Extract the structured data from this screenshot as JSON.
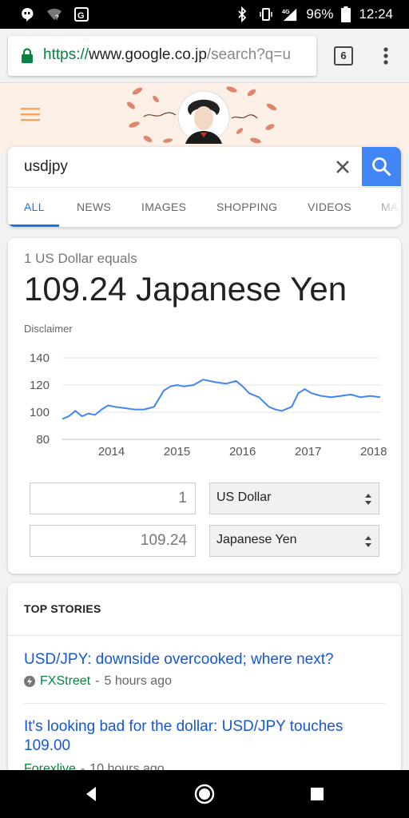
{
  "status_bar": {
    "battery": "96%",
    "time": "12:24",
    "network": "4G"
  },
  "browser": {
    "url_scheme": "https://",
    "url_host": "www.google.co.jp",
    "url_path": "/search?q=u",
    "tab_count": "6"
  },
  "search": {
    "query": "usdjpy",
    "tabs": [
      {
        "label": "ALL"
      },
      {
        "label": "NEWS"
      },
      {
        "label": "IMAGES"
      },
      {
        "label": "SHOPPING"
      },
      {
        "label": "VIDEOS"
      },
      {
        "label": "MA"
      }
    ],
    "active_tab": "ALL"
  },
  "currency": {
    "from_label": "1 US Dollar equals",
    "result": "109.24 Japanese Yen",
    "disclaimer": "Disclaimer",
    "amount_from": "1",
    "currency_from": "US Dollar",
    "amount_to": "109.24",
    "currency_to": "Japanese Yen"
  },
  "chart_data": {
    "type": "line",
    "title": "",
    "xlabel": "",
    "ylabel": "",
    "x_ticks": [
      "2014",
      "2015",
      "2016",
      "2017",
      "2018"
    ],
    "y_ticks": [
      80,
      100,
      120,
      140
    ],
    "ylim": [
      80,
      140
    ],
    "xlim": [
      2013.25,
      2018.1
    ],
    "grid": true,
    "color": "#4285f4",
    "series": [
      {
        "x": [
          2013.25,
          2013.35,
          2013.45,
          2013.55,
          2013.65,
          2013.75,
          2013.85,
          2013.95,
          2014.05,
          2014.2,
          2014.35,
          2014.5,
          2014.65,
          2014.8,
          2014.9,
          2015.0,
          2015.1,
          2015.25,
          2015.4,
          2015.5,
          2015.6,
          2015.75,
          2015.9,
          2016.0,
          2016.1,
          2016.25,
          2016.4,
          2016.5,
          2016.6,
          2016.75,
          2016.85,
          2016.95,
          2017.05,
          2017.2,
          2017.35,
          2017.5,
          2017.65,
          2017.8,
          2017.95,
          2018.1
        ],
        "y": [
          95,
          97,
          101,
          97,
          99,
          98,
          102,
          105,
          104,
          103,
          102,
          102,
          104,
          116,
          119,
          120,
          119,
          120,
          124,
          123,
          122,
          121,
          123,
          119,
          114,
          111,
          104,
          102,
          101,
          104,
          114,
          117,
          114,
          112,
          111,
          112,
          113,
          111,
          112,
          111
        ]
      }
    ]
  },
  "top_stories": {
    "title": "TOP STORIES",
    "items": [
      {
        "headline": "USD/JPY: downside overcooked; where next?",
        "source": "FXStreet",
        "age": "5 hours ago"
      },
      {
        "headline": "It's looking bad for the dollar: USD/JPY touches 109.00",
        "source": "Forexlive",
        "age": "10 hours ago"
      }
    ]
  },
  "colors": {
    "accent": "#4285f4",
    "link": "#1558d6",
    "source_green": "#0b8043"
  }
}
